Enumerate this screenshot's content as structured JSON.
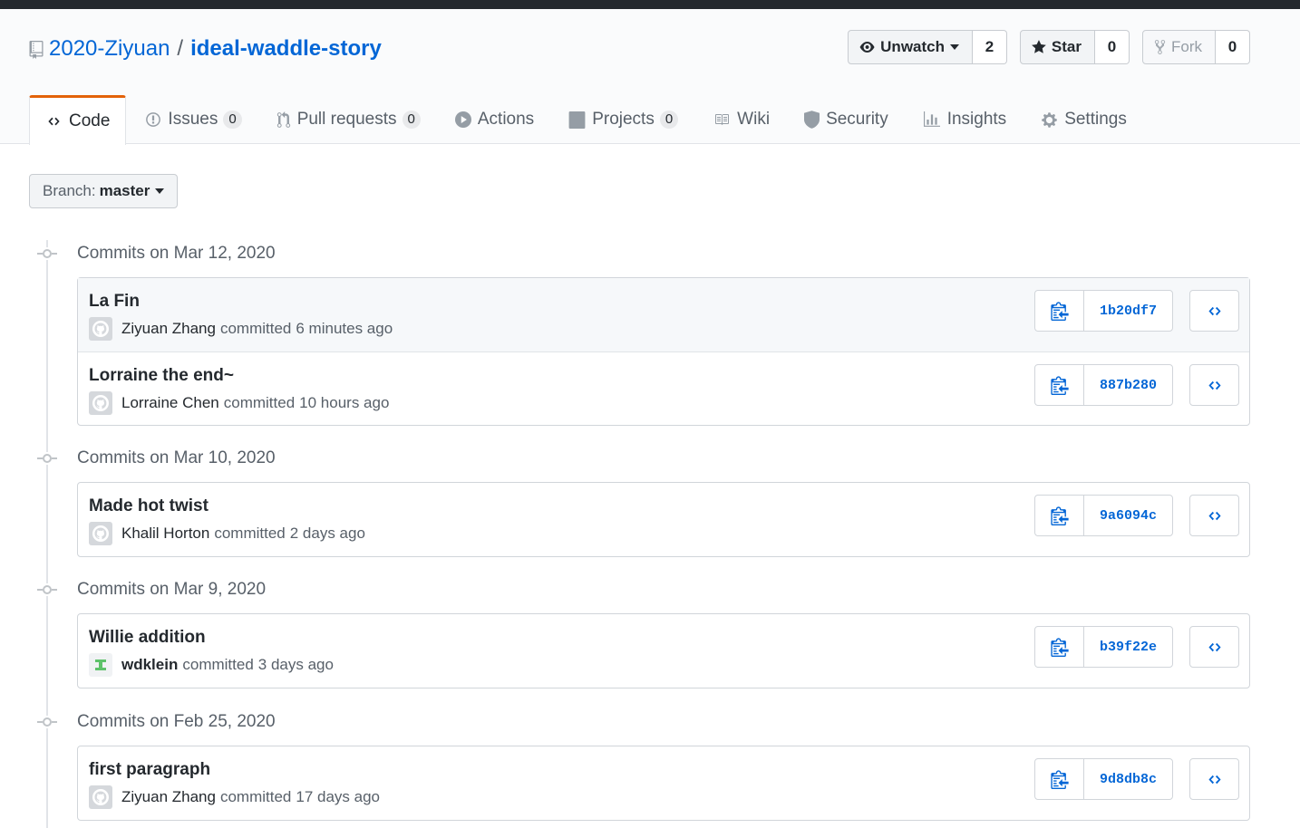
{
  "repo": {
    "owner": "2020-Ziyuan",
    "separator": "/",
    "name": "ideal-waddle-story"
  },
  "actions": {
    "watch": {
      "label": "Unwatch",
      "count": "2"
    },
    "star": {
      "label": "Star",
      "count": "0"
    },
    "fork": {
      "label": "Fork",
      "count": "0"
    }
  },
  "tabs": [
    {
      "label": "Code",
      "icon": "code-icon"
    },
    {
      "label": "Issues",
      "icon": "issue-icon",
      "count": "0"
    },
    {
      "label": "Pull requests",
      "icon": "pull-request-icon",
      "count": "0"
    },
    {
      "label": "Actions",
      "icon": "play-icon"
    },
    {
      "label": "Projects",
      "icon": "project-icon",
      "count": "0"
    },
    {
      "label": "Wiki",
      "icon": "book-icon"
    },
    {
      "label": "Security",
      "icon": "shield-icon"
    },
    {
      "label": "Insights",
      "icon": "graph-icon"
    },
    {
      "label": "Settings",
      "icon": "gear-icon"
    }
  ],
  "branch": {
    "label": "Branch:",
    "value": "master"
  },
  "groups": [
    {
      "date": "Commits on Mar 12, 2020",
      "commits": [
        {
          "message": "La Fin",
          "author": "Ziyuan Zhang",
          "action": "committed",
          "time": "6 minutes ago",
          "sha": "1b20df7"
        },
        {
          "message": "Lorraine the end~",
          "author": "Lorraine Chen",
          "action": "committed",
          "time": "10 hours ago",
          "sha": "887b280"
        }
      ]
    },
    {
      "date": "Commits on Mar 10, 2020",
      "commits": [
        {
          "message": "Made hot twist",
          "author": "Khalil Horton",
          "action": "committed",
          "time": "2 days ago",
          "sha": "9a6094c"
        }
      ]
    },
    {
      "date": "Commits on Mar 9, 2020",
      "commits": [
        {
          "message": "Willie addition",
          "author": "wdklein",
          "action": "committed",
          "time": "3 days ago",
          "sha": "b39f22e"
        }
      ]
    },
    {
      "date": "Commits on Feb 25, 2020",
      "commits": [
        {
          "message": "first paragraph",
          "author": "Ziyuan Zhang",
          "action": "committed",
          "time": "17 days ago",
          "sha": "9d8db8c"
        }
      ]
    }
  ],
  "colors": {
    "link": "#0366d6",
    "tab_accent": "#e36209",
    "text": "#24292e",
    "muted": "#586069"
  }
}
